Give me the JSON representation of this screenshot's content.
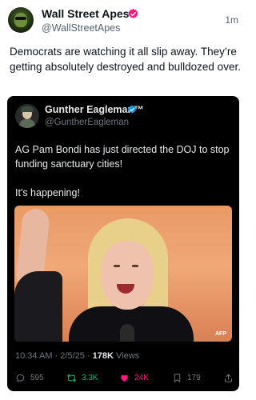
{
  "tweet": {
    "author_name": "Wall Street Apes",
    "author_handle": "@WallStreetApes",
    "time": "1m",
    "text": "Democrats are watching it all slip away. They’re getting absolutely destroyed and bulldozed over."
  },
  "quoted": {
    "author_name": "Gunther Eagleman™",
    "author_handle": "@GuntherEagleman",
    "paragraph_1": "AG Pam Bondi has just directed the DOJ to stop funding sanctuary cities!",
    "paragraph_2": "It's happening!",
    "photo_credit": "AFP",
    "meta": {
      "time": "10:34 AM",
      "date": "2/5/25",
      "views_count": "178K",
      "views_label": "Views"
    },
    "actions": {
      "replies": "595",
      "reposts": "3.3K",
      "likes": "24K",
      "bookmarks": "179"
    }
  },
  "colors": {
    "verified_blue": "#1d9bf0",
    "like_pink": "#f91880",
    "repost_green": "#00ba7c",
    "muted": "#536471"
  },
  "icons": [
    "verified-badge-icon",
    "reply-icon",
    "repost-icon",
    "like-icon",
    "bookmark-icon",
    "share-icon"
  ]
}
